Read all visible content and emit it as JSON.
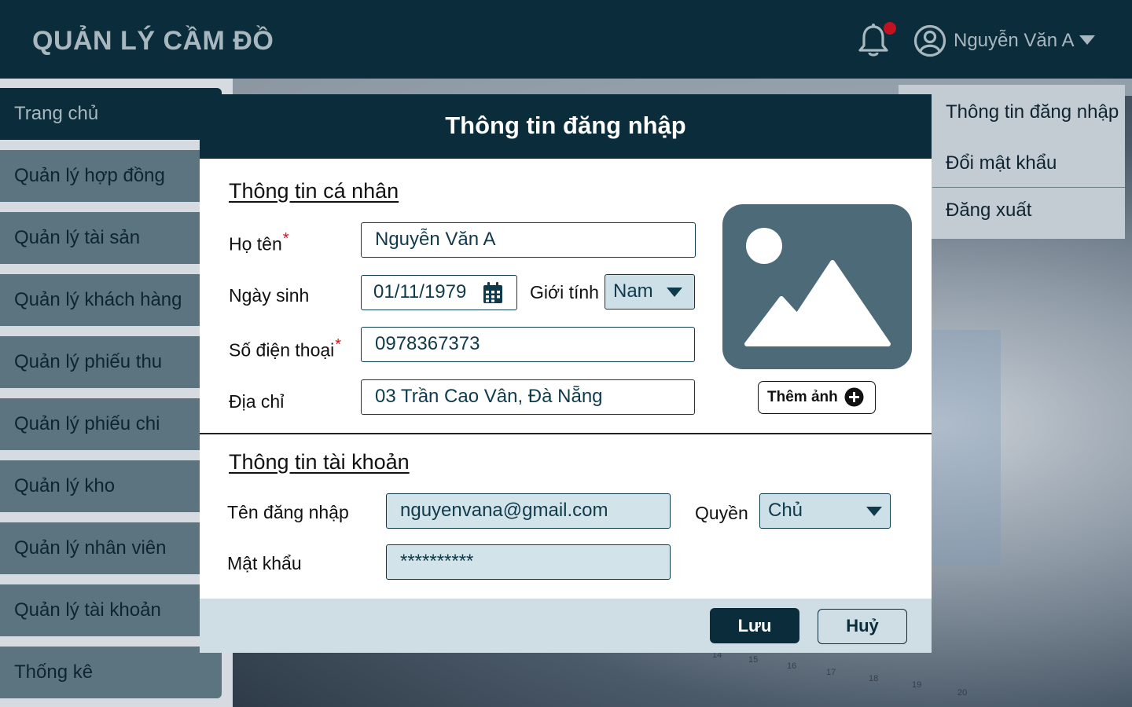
{
  "header": {
    "app_title": "QUẢN LÝ CẦM ĐỒ",
    "user_name": "Nguyễn Văn A"
  },
  "sidebar": {
    "items": [
      {
        "label": "Trang chủ",
        "active": true
      },
      {
        "label": "Quản lý hợp đồng"
      },
      {
        "label": "Quản lý tài sản"
      },
      {
        "label": "Quản lý khách hàng"
      },
      {
        "label": "Quản lý phiếu thu"
      },
      {
        "label": "Quản lý phiếu chi"
      },
      {
        "label": "Quản lý kho"
      },
      {
        "label": "Quản lý nhân viên"
      },
      {
        "label": "Quản lý tài khoản"
      },
      {
        "label": "Thống kê"
      }
    ]
  },
  "user_menu": {
    "items": [
      {
        "label": "Thông tin đăng nhập"
      },
      {
        "label": "Đổi mật khẩu"
      },
      {
        "label": "Đăng xuất"
      }
    ]
  },
  "background": {
    "ghost_numbers": [
      "14",
      "15",
      "16",
      "17",
      "18",
      "19",
      "20"
    ]
  },
  "modal": {
    "title": "Thông tin đăng nhập",
    "personal": {
      "section_title": "Thông tin cá nhân",
      "name_label": "Họ tên",
      "name_value": "Nguyễn Văn A",
      "dob_label": "Ngày sinh",
      "dob_value": "01/11/1979",
      "gender_label": "Giới tính",
      "gender_value": "Nam",
      "phone_label": "Số điện thoại",
      "phone_value": "0978367373",
      "address_label": "Địa chỉ",
      "address_value": "03 Trần Cao Vân, Đà Nẵng",
      "add_photo_label": "Thêm ảnh",
      "required_mark": "*"
    },
    "account": {
      "section_title": "Thông tin tài khoản",
      "username_label": "Tên đăng nhập",
      "username_value": "nguyenvana@gmail.com",
      "role_label": "Quyền",
      "role_value": "Chủ",
      "password_label": "Mật khẩu",
      "password_value": "**********"
    },
    "save_label": "Lưu",
    "cancel_label": "Huỷ"
  },
  "colors": {
    "primary": "#0a2c3b",
    "sidebar_item": "#5c7480",
    "accent_red": "#c1121f",
    "field_shade": "#d3e3ea"
  }
}
